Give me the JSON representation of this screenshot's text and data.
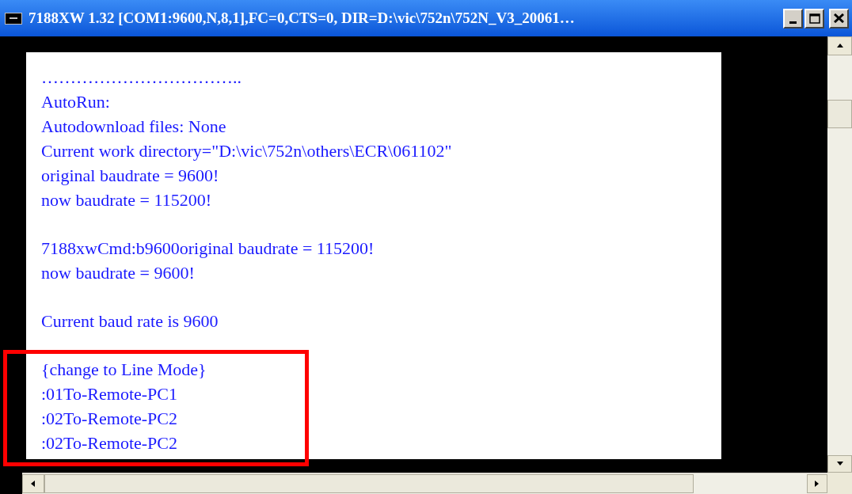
{
  "window": {
    "title": "7188XW 1.32 [COM1:9600,N,8,1],FC=0,CTS=0, DIR=D:\\vic\\752n\\752N_V3_20061…"
  },
  "console": {
    "blocks": [
      {
        "highlighted": false,
        "lines": [
          "……………………………..",
          "AutoRun:",
          "Autodownload files: None",
          "Current work directory=\"D:\\vic\\752n\\others\\ECR\\061102\"",
          "original baudrate = 9600!",
          "now baudrate = 115200!"
        ]
      },
      {
        "highlighted": false,
        "lines": [
          "7188xwCmd:b9600original baudrate = 115200!",
          "now baudrate = 9600!"
        ]
      },
      {
        "highlighted": false,
        "lines": [
          "Current baud rate is 9600"
        ]
      },
      {
        "highlighted": true,
        "lines": [
          "{change to Line Mode}",
          ":01To-Remote-PC1",
          ":02To-Remote-PC2",
          ":02To-Remote-PC2"
        ]
      }
    ]
  }
}
